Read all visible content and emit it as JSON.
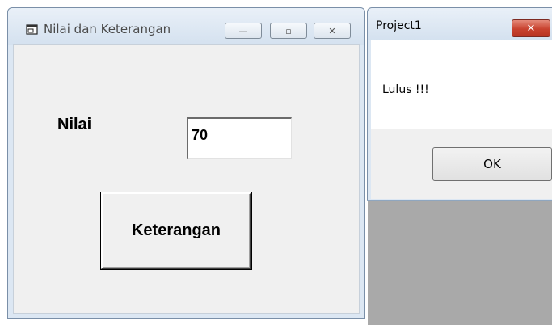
{
  "main_window": {
    "title": "Nilai dan Keterangan",
    "minimize_glyph": "—",
    "restore_glyph": "▫",
    "close_glyph": "✕",
    "label_nilai": "Nilai",
    "input_nilai_value": "70",
    "button_keterangan": "Keterangan"
  },
  "message_box": {
    "title": "Project1",
    "close_glyph": "✕",
    "message": "Lulus !!!",
    "ok_label": "OK"
  },
  "colors": {
    "titlebar": "#dce7f3",
    "form_background": "#f0f0f0",
    "close_button_red": "#c8422f",
    "desktop_gray": "#a9a9a9"
  }
}
